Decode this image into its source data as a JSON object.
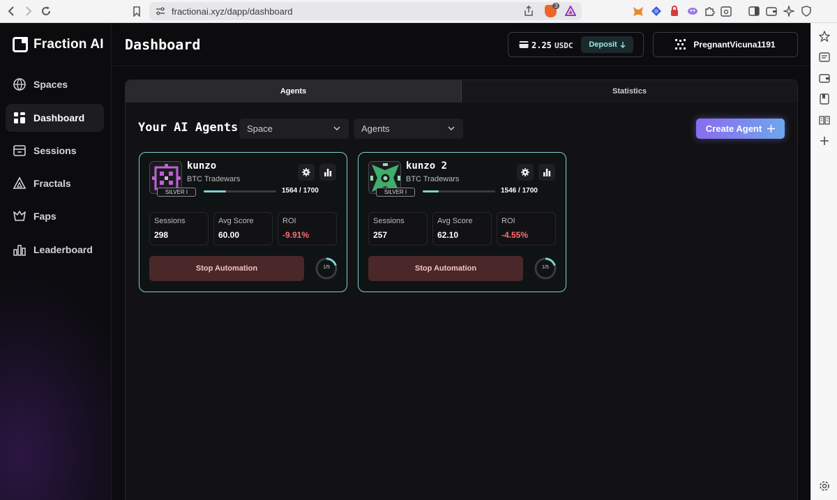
{
  "browser": {
    "url": "fractionai.xyz/dapp/dashboard",
    "brave_badge": "3"
  },
  "app": {
    "brand": "Fraction AI",
    "page_title": "Dashboard",
    "sidebar": [
      {
        "label": "Spaces",
        "icon": "spaces-icon",
        "active": false
      },
      {
        "label": "Dashboard",
        "icon": "dashboard-icon",
        "active": true
      },
      {
        "label": "Sessions",
        "icon": "sessions-icon",
        "active": false
      },
      {
        "label": "Fractals",
        "icon": "fractals-icon",
        "active": false
      },
      {
        "label": "Faps",
        "icon": "faps-icon",
        "active": false
      },
      {
        "label": "Leaderboard",
        "icon": "leaderboard-icon",
        "active": false
      }
    ],
    "wallet": {
      "amount": "2.25",
      "currency": "USDC",
      "deposit_label": "Deposit"
    },
    "user": {
      "name": "PregnantVicuna1191"
    },
    "tabs": [
      {
        "label": "Agents",
        "active": true
      },
      {
        "label": "Statistics",
        "active": false
      }
    ],
    "section_title": "Your AI Agents",
    "filters": {
      "space": "Space",
      "agents": "Agents"
    },
    "create_button": "Create Agent",
    "agents": [
      {
        "name": "kunzo",
        "space": "BTC Tradewars",
        "rank": "SILVER I",
        "progress_text": "1564 / 1700",
        "progress_fraction": 0.31,
        "stats": [
          {
            "label": "Sessions",
            "value": "298"
          },
          {
            "label": "Avg Score",
            "value": "60.00"
          },
          {
            "label": "ROI",
            "value": "-9.91%"
          }
        ],
        "stop_label": "Stop Automation",
        "ring_text": "1/5",
        "ring_fraction": 0.2,
        "avatar_color": "#c05fd6"
      },
      {
        "name": "kunzo 2",
        "space": "BTC Tradewars",
        "rank": "SILVER I",
        "progress_text": "1546 / 1700",
        "progress_fraction": 0.22,
        "stats": [
          {
            "label": "Sessions",
            "value": "257"
          },
          {
            "label": "Avg Score",
            "value": "62.10"
          },
          {
            "label": "ROI",
            "value": "-4.55%"
          }
        ],
        "stop_label": "Stop Automation",
        "ring_text": "1/5",
        "ring_fraction": 0.2,
        "avatar_color": "#3fae6a"
      }
    ]
  },
  "colors": {
    "accent_teal": "#7fd0cf",
    "negative": "#ff6f6f",
    "stop_bg": "#4a2728"
  }
}
